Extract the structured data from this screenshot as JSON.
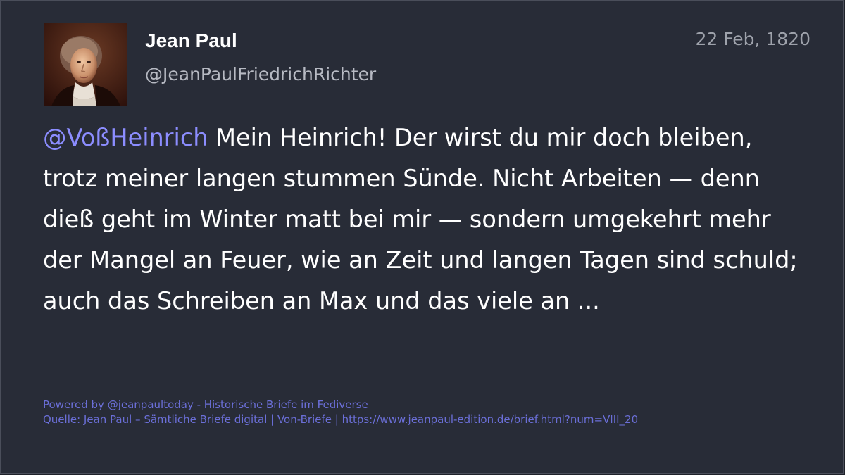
{
  "post": {
    "author": {
      "display_name": "Jean Paul",
      "handle": "@JeanPaulFriedrichRichter",
      "avatar": "portrait-avatar"
    },
    "date": "22 Feb, 1820",
    "mention": "@VoßHeinrich",
    "text": " Mein Heinrich! Der wirst du mir doch bleiben, trotz meiner langen stummen Sünde. Nicht Arbeiten — denn dieß geht im Winter matt bei mir — sondern umgekehrt mehr der Mangel an Feuer, wie an Zeit und langen Tagen sind schuld; auch das Schreiben an Max und das viele an ...",
    "mention_color": "#8c8dff"
  },
  "footer": {
    "powered_by": "Powered by @jeanpaultoday - Historische Briefe im Fediverse",
    "source": "Quelle: Jean Paul – Sämtliche Briefe digital | Von-Briefe | https://www.jeanpaul-edition.de/brief.html?num=VIII_20"
  },
  "colors": {
    "background": "#282c37",
    "text": "#ffffff",
    "muted": "#b7bac3",
    "link": "#6b6fd8"
  }
}
